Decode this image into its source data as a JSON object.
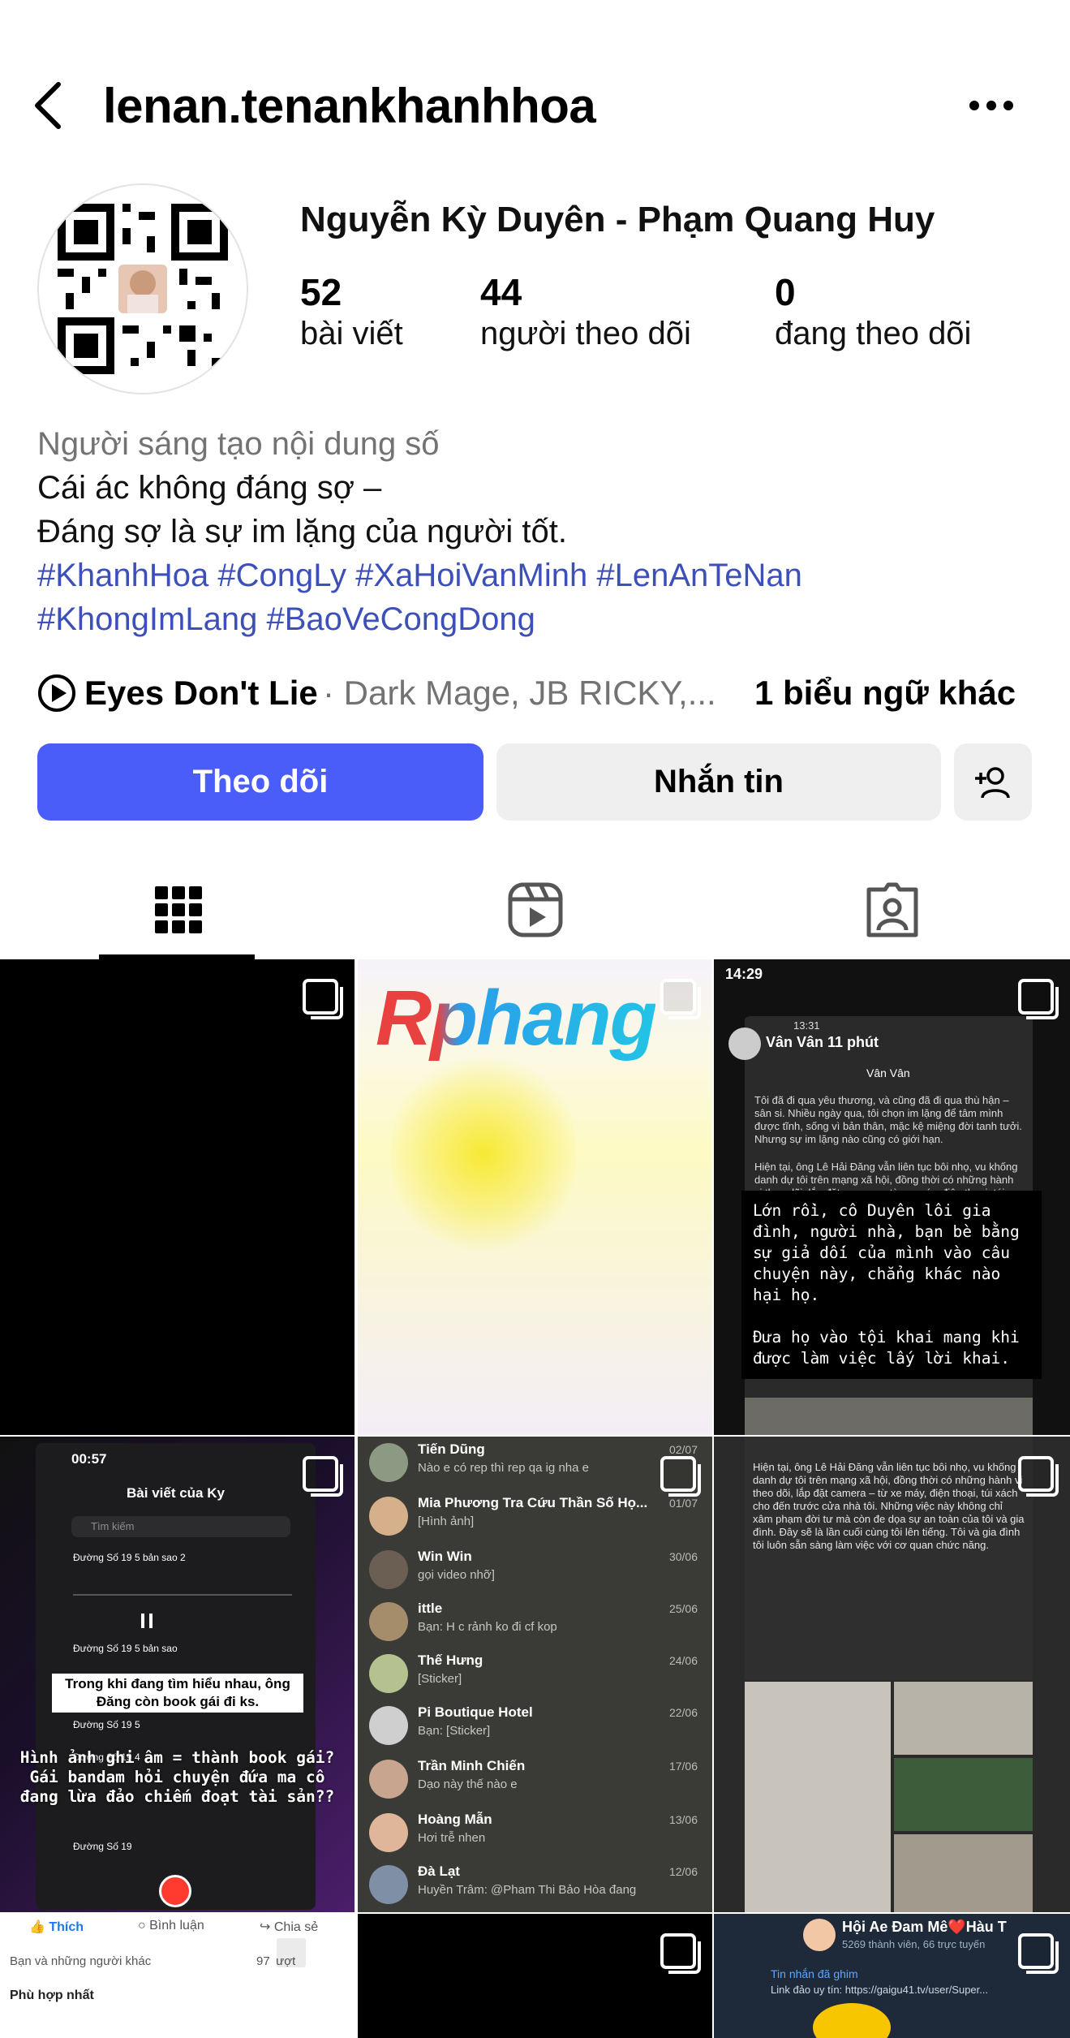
{
  "header": {
    "username": "lenan.tenankhanhhoa"
  },
  "profile": {
    "display_name": "Nguyễn Kỳ Duyên - Phạm Quang Huy",
    "stats": [
      {
        "value": "52",
        "label": "bài viết"
      },
      {
        "value": "44",
        "label": "người theo dõi"
      },
      {
        "value": "0",
        "label": "đang theo dõi"
      }
    ],
    "bio": {
      "category": "Người sáng tạo nội dung số",
      "line1": "Cái ác không đáng sợ –",
      "line2": "Đáng sợ là sự im lặng của người tốt.",
      "tags_line1": "#KhanhHoa #CongLy #XaHoiVanMinh #LenAnTeNan",
      "tags_line2": "#KhongImLang #BaoVeCongDong"
    },
    "music": {
      "title": "Eyes Don't Lie",
      "artists": "· Dark Mage, JB RICKY,...",
      "more": "1 biểu ngữ khác"
    }
  },
  "actions": {
    "follow_label": "Theo dõi",
    "message_label": "Nhắn tin"
  },
  "tabs": [
    {
      "name": "posts",
      "icon": "grid-icon",
      "active": true
    },
    {
      "name": "reels",
      "icon": "reels-icon",
      "active": false
    },
    {
      "name": "tagged",
      "icon": "tagged-icon",
      "active": false
    }
  ],
  "posts": {
    "p2_logo": "Rphang",
    "p3": {
      "time": "14:29",
      "inner_time": "13:31",
      "author": "Vân Vân 11 phút",
      "header_name": "Vân Vân",
      "para1": "Tôi đã đi qua yêu thương, và cũng đã đi qua thù hận – sân si. Nhiều ngày qua, tôi chọn im lặng để tâm mình được tĩnh, sống vì bản thân, mặc kệ miệng đời tanh tưởi. Nhưng sự im lặng nào cũng có giới hạn.",
      "para2": "Hiện tại, ông Lê Hải Đăng vẫn liên tục bôi nhọ, vu khống danh dự tôi trên mạng xã hội, đồng thời có những hành vi theo dõi, lắp đặt camera – từ xe máy, điện thoại, túi xách cho đến trước cửa nhà tôi.",
      "caption": "Lớn rồi, cô Duyên lôi gia đình, người nhà, bạn bè bằng sự giả dối của mình vào câu chuyện này, chẳng khác nào hại họ.\n\nĐưa họ vào tội khai mang khi được làm việc lấy lời khai."
    },
    "p4": {
      "time": "00:57",
      "title": "Bài viết của Ky",
      "search": "Tìm kiếm",
      "rec1": "Đường Số 19 5 bản sao 2",
      "rec2": "Đường Số 19 5 bản sao",
      "rec3": "Đường Số 19 5",
      "rec4": "Đường Số 19 4",
      "rec5": "Đường Số 19",
      "overlay1": "Trong khi đang tìm hiểu nhau, ông Đăng còn book gái đi ks.",
      "overlay2": "Hình ảnh ghi âm = thành book gái? Gái bandam hỏi chuyện đứa ma cô đang lừa đảo chiếm đoạt tài sản??"
    },
    "p5_chats": [
      {
        "name": "Tiến Dũng",
        "msg": "Nào e có rep thì rep qa ig nha e",
        "date": "02/07"
      },
      {
        "name": "Mia Phương Tra Cứu Thần Số Họ...",
        "msg": "[Hình ảnh]",
        "date": "01/07"
      },
      {
        "name": "Win Win",
        "msg": "gọi video nhỡ]",
        "date": "30/06"
      },
      {
        "name": "ittle",
        "msg": "Bạn: H c rảnh ko đi cf kop",
        "date": "25/06"
      },
      {
        "name": "Thế Hưng",
        "msg": "[Sticker]",
        "date": "24/06"
      },
      {
        "name": "Pi Boutique Hotel",
        "msg": "Bạn: [Sticker]",
        "date": "22/06"
      },
      {
        "name": "Trần Minh Chiến",
        "msg": "Dạo này thế nào e",
        "date": "17/06"
      },
      {
        "name": "Hoàng Mẫn",
        "msg": "Hơi trễ nhen",
        "date": "13/06"
      },
      {
        "name": "Đà Lạt",
        "msg": "Huyền Trâm: @Pham Thi Bảo Hòa  đang",
        "date": "12/06"
      }
    ],
    "p6": {
      "text": "Hiện tại, ông Lê Hải Đăng vẫn liên tục bôi nhọ, vu khống danh dự tôi trên mạng xã hội, đồng thời có những hành vi theo dõi, lắp đặt camera – từ xe máy, điện thoại, túi xách cho đến trước cửa nhà tôi. Những việc này không chỉ xâm phạm đời tư mà còn đe dọa sự an toàn của tôi và gia đình. Đây sẽ là lần cuối cùng tôi lên tiếng. Tôi và gia đình tôi luôn sẵn sàng làm việc với cơ quan chức năng."
    },
    "p7": {
      "like": "Thích",
      "comment": "Bình luận",
      "share": "Chia sẻ",
      "reactions": "Bạn và những người khác",
      "views": "97 lượt",
      "sort": "Phù hợp nhất"
    },
    "p9": {
      "group": "Hội Ae Đam Mê❤️Hàu T",
      "members": "5269 thành viên, 66 trực tuyến",
      "pinned": "Tin nhắn đã ghim",
      "link": "Link đảo uy tín: https://gaigu41.tv/user/Super..."
    }
  },
  "colors": {
    "follow_button": "#4a5df9",
    "hashtag": "#3d4fb8",
    "secondary_text": "#737373",
    "button_gray": "#efefef"
  }
}
